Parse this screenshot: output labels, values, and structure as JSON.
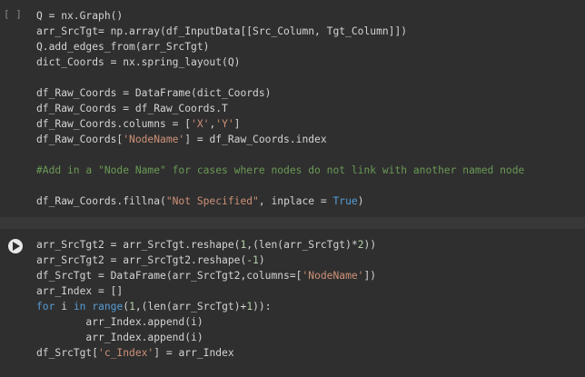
{
  "cells": [
    {
      "execution_indicator": "[ ]",
      "lines": [
        [
          {
            "t": "Q = nx.Graph()",
            "c": "plain"
          }
        ],
        [
          {
            "t": "arr_SrcTgt= np.array(df_InputData[[Src_Column, Tgt_Column]])",
            "c": "plain"
          }
        ],
        [
          {
            "t": "Q.add_edges_from(arr_SrcTgt)",
            "c": "plain"
          }
        ],
        [
          {
            "t": "dict_Coords = nx.spring_layout(Q)",
            "c": "plain"
          }
        ],
        [
          {
            "t": "",
            "c": "plain"
          }
        ],
        [
          {
            "t": "df_Raw_Coords = DataFrame(dict_Coords)",
            "c": "plain"
          }
        ],
        [
          {
            "t": "df_Raw_Coords = df_Raw_Coords.T",
            "c": "plain"
          }
        ],
        [
          {
            "t": "df_Raw_Coords.columns = [",
            "c": "plain"
          },
          {
            "t": "'X'",
            "c": "str"
          },
          {
            "t": ",",
            "c": "plain"
          },
          {
            "t": "'Y'",
            "c": "str"
          },
          {
            "t": "]",
            "c": "plain"
          }
        ],
        [
          {
            "t": "df_Raw_Coords[",
            "c": "plain"
          },
          {
            "t": "'NodeName'",
            "c": "str"
          },
          {
            "t": "] = df_Raw_Coords.index",
            "c": "plain"
          }
        ],
        [
          {
            "t": "",
            "c": "plain"
          }
        ],
        [
          {
            "t": "#Add in a \"Node Name\" for cases where nodes do not link with another named node",
            "c": "cmt"
          }
        ],
        [
          {
            "t": "",
            "c": "plain"
          }
        ],
        [
          {
            "t": "df_Raw_Coords.fillna(",
            "c": "plain"
          },
          {
            "t": "\"Not Specified\"",
            "c": "str"
          },
          {
            "t": ", inplace = ",
            "c": "plain"
          },
          {
            "t": "True",
            "c": "kw"
          },
          {
            "t": ")",
            "c": "plain"
          }
        ]
      ]
    },
    {
      "lines": [
        [
          {
            "t": "arr_SrcTgt2 = arr_SrcTgt.reshape(",
            "c": "plain"
          },
          {
            "t": "1",
            "c": "num"
          },
          {
            "t": ",(len(arr_SrcTgt)*",
            "c": "plain"
          },
          {
            "t": "2",
            "c": "num"
          },
          {
            "t": "))",
            "c": "plain"
          }
        ],
        [
          {
            "t": "arr_SrcTgt2 = arr_SrcTgt2.reshape(",
            "c": "plain"
          },
          {
            "t": "-1",
            "c": "num"
          },
          {
            "t": ")",
            "c": "plain"
          }
        ],
        [
          {
            "t": "df_SrcTgt = DataFrame(arr_SrcTgt2,columns=[",
            "c": "plain"
          },
          {
            "t": "'NodeName'",
            "c": "str"
          },
          {
            "t": "])",
            "c": "plain"
          }
        ],
        [
          {
            "t": "arr_Index = []",
            "c": "plain"
          }
        ],
        [
          {
            "t": "for",
            "c": "kw"
          },
          {
            "t": " i ",
            "c": "plain"
          },
          {
            "t": "in",
            "c": "kw"
          },
          {
            "t": " ",
            "c": "plain"
          },
          {
            "t": "range",
            "c": "kw"
          },
          {
            "t": "(",
            "c": "plain"
          },
          {
            "t": "1",
            "c": "num"
          },
          {
            "t": ",(len(arr_SrcTgt)+",
            "c": "plain"
          },
          {
            "t": "1",
            "c": "num"
          },
          {
            "t": ")):",
            "c": "plain"
          }
        ],
        [
          {
            "t": "        arr_Index.append(i)",
            "c": "plain"
          }
        ],
        [
          {
            "t": "        arr_Index.append(i)",
            "c": "plain"
          }
        ],
        [
          {
            "t": "df_SrcTgt[",
            "c": "plain"
          },
          {
            "t": "'c_Index'",
            "c": "str"
          },
          {
            "t": "] = arr_Index",
            "c": "plain"
          }
        ]
      ]
    }
  ],
  "colors": {
    "background": "#383838",
    "cell_background": "#2f2f2f",
    "text": "#d4d4d4",
    "string": "#ce9178",
    "keyword": "#569cd6",
    "number": "#b5cea8",
    "comment": "#6a9955",
    "run_button": "#e8e8e8"
  },
  "icons": {
    "run_button": "play-icon"
  }
}
